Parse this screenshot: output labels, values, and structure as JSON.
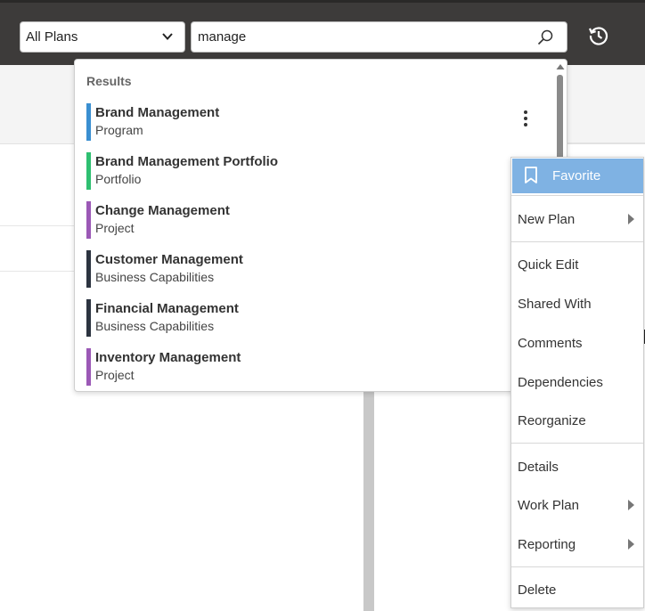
{
  "header": {
    "plan_filter": {
      "value": "All Plans",
      "icon": "chevron-down-icon"
    },
    "search": {
      "value": "manage",
      "icon": "search-icon"
    },
    "history_icon": "history-icon"
  },
  "results": {
    "heading": "Results",
    "items": [
      {
        "name": "Brand Management",
        "type": "Program",
        "color": "#3a8fd1"
      },
      {
        "name": "Brand Management Portfolio",
        "type": "Portfolio",
        "color": "#2fbf71"
      },
      {
        "name": "Change Management",
        "type": "Project",
        "color": "#9b59b6"
      },
      {
        "name": "Customer Management",
        "type": "Business Capabilities",
        "color": "#2c3440"
      },
      {
        "name": "Financial Management",
        "type": "Business Capabilities",
        "color": "#2c3440"
      },
      {
        "name": "Inventory Management",
        "type": "Project",
        "color": "#9b59b6"
      }
    ],
    "more_icon": "more-vertical-icon"
  },
  "context_menu": {
    "favorite": {
      "label": "Favorite",
      "icon": "bookmark-icon",
      "highlight": "#7fb2e3"
    },
    "items": [
      {
        "label": "New Plan",
        "submenu": true
      },
      {
        "label": "Quick Edit",
        "submenu": false
      },
      {
        "label": "Shared With",
        "submenu": false
      },
      {
        "label": "Comments",
        "submenu": false
      },
      {
        "label": "Dependencies",
        "submenu": false
      },
      {
        "label": "Reorganize",
        "submenu": false
      },
      {
        "label": "Details",
        "submenu": false
      },
      {
        "label": "Work Plan",
        "submenu": true
      },
      {
        "label": "Reporting",
        "submenu": true
      },
      {
        "label": "Delete",
        "submenu": false
      }
    ]
  }
}
